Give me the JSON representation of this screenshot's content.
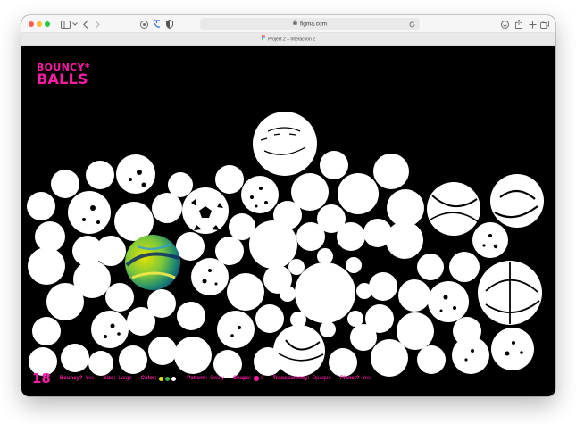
{
  "browser": {
    "url": "figma.com",
    "tab_title": "Project 2 – Interaction 2"
  },
  "brand": {
    "line1": "BOUNCY*",
    "line2": "BALLS",
    "color": "#ff1aa8"
  },
  "footer": {
    "count": "18",
    "bouncy_label": "Bouncy?",
    "bouncy_value": "Yes",
    "size_label": "Size:",
    "size_value": "Large",
    "color_label": "Color:",
    "colors": [
      "#e8e200",
      "#3cb043",
      "#ffffff"
    ],
    "pattern_label": "Pattern:",
    "pattern_value": "Swirly",
    "shape_label": "Shape:",
    "shape_value": "0",
    "transparency_label": "Transparency:",
    "transparency_value": "Opaque",
    "planet_label": "Planet?",
    "planet_value": "Yes"
  }
}
